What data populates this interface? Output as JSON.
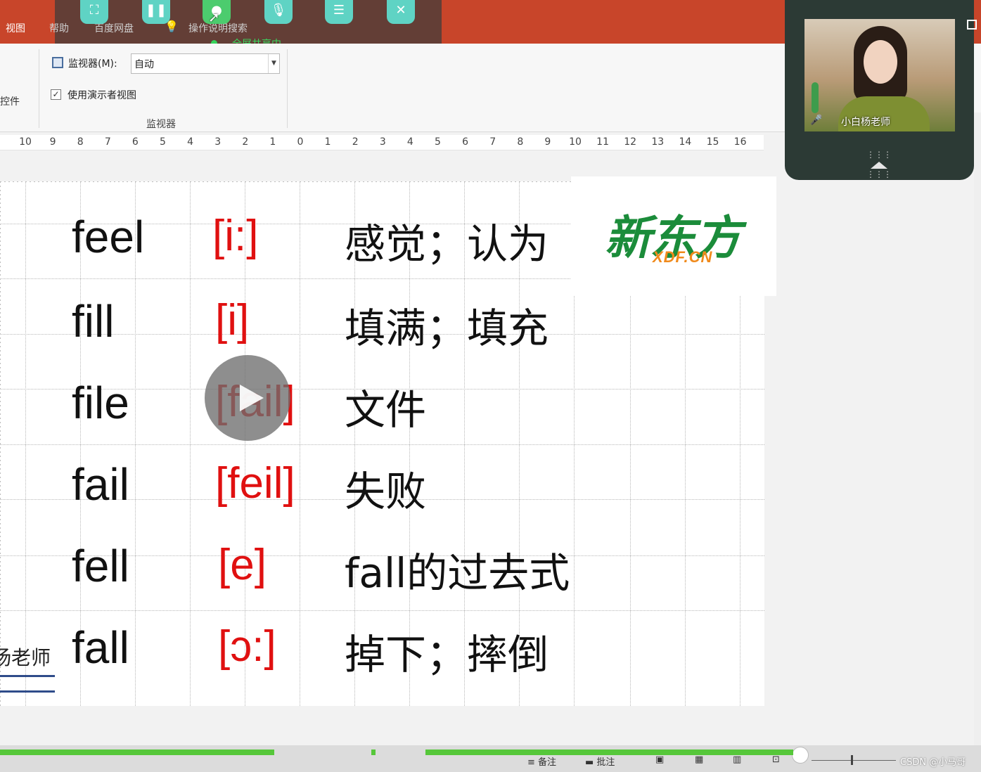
{
  "ribbon_tabs": {
    "view": "视图",
    "help": "帮助",
    "baidu_disk": "百度网盘",
    "search": "操作说明搜索"
  },
  "share_toolbar": {
    "status": "全屏共享中",
    "buttons": [
      "fullscreen-icon",
      "pause-icon",
      "record-icon",
      "mic-icon",
      "settings-icon",
      "close-icon"
    ]
  },
  "ribbon": {
    "controls_label": "控件",
    "monitor_label": "监视器(M):",
    "monitor_value": "自动",
    "presenter_view_label": "使用演示者视图",
    "presenter_view_checked": true,
    "group_label": "监视器"
  },
  "ruler": {
    "ticks": [
      "10",
      "9",
      "8",
      "7",
      "6",
      "5",
      "4",
      "3",
      "2",
      "1",
      "0",
      "1",
      "2",
      "3",
      "4",
      "5",
      "6",
      "7",
      "8",
      "9",
      "10",
      "11",
      "12",
      "13",
      "14",
      "15",
      "16"
    ]
  },
  "slide": {
    "rows": [
      {
        "word": "feel",
        "ipa": "[i:]",
        "meaning": "感觉；认为"
      },
      {
        "word": "fill",
        "ipa": "[i]",
        "meaning": "填满；填充"
      },
      {
        "word": "file",
        "ipa": "[fail]",
        "meaning": "文件"
      },
      {
        "word": "fail",
        "ipa": "[feil]",
        "meaning": "失败"
      },
      {
        "word": "fell",
        "ipa": "[e]",
        "meaning": "fall的过去式"
      },
      {
        "word": "fall",
        "ipa": "[ɔ:]",
        "meaning": "掉下；摔倒"
      }
    ],
    "teacher_name": "杨老师",
    "logo_main": "新东方",
    "logo_sub": "XDF.CN"
  },
  "webcam": {
    "name": "小白杨老师"
  },
  "statusbar": {
    "notes": "备注",
    "comments": "批注",
    "watermark": "CSDN @小马哥"
  },
  "colors": {
    "ribbon_accent": "#c8452a",
    "ipa_red": "#e01010",
    "share_green": "#39d95f",
    "logo_green": "#1b8c3a",
    "logo_orange": "#f08a1c",
    "progress_green": "#56c73a"
  }
}
